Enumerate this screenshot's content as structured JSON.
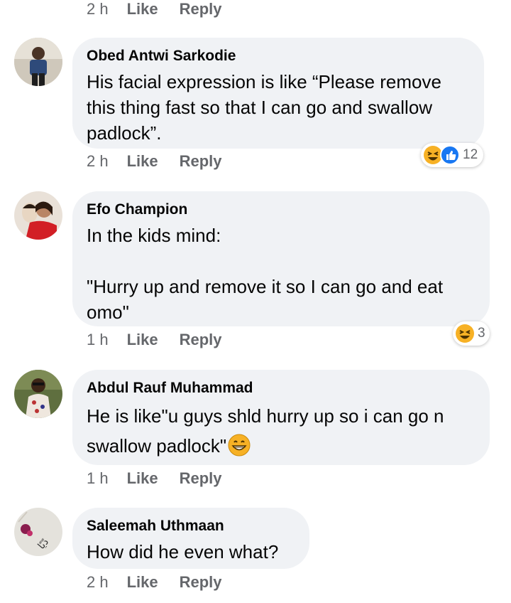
{
  "top_meta": {
    "time": "2 h",
    "like": "Like",
    "reply": "Reply"
  },
  "comments": [
    {
      "author": "Obed Antwi Sarkodie",
      "text": "His facial expression is like “Please remove this thing fast so that I can go and swallow padlock”.",
      "time": "2 h",
      "like": "Like",
      "reply": "Reply",
      "reaction_count": "12",
      "reactions": [
        "laugh-emoji",
        "like-thumb"
      ]
    },
    {
      "author": "Efo Champion",
      "text": "In the kids mind:\n\n\"Hurry up and remove it so I can go and eat omo\"",
      "time": "1 h",
      "like": "Like",
      "reply": "Reply",
      "reaction_count": "3",
      "reactions": [
        "laugh-emoji"
      ]
    },
    {
      "author": "Abdul Rauf Muhammad",
      "text_line1": "He is like\"u guys shld hurry up so i can go n",
      "text_line2": "swallow padlock\"",
      "inline_emoji": "grinning-emoji",
      "time": "1 h",
      "like": "Like",
      "reply": "Reply"
    },
    {
      "author": "Saleemah Uthmaan",
      "text": "How did he even what?",
      "time": "2 h",
      "like": "Like",
      "reply": "Reply"
    }
  ],
  "colors": {
    "bubble": "#f0f2f5",
    "meta_text": "#65676b",
    "like_blue": "#1877f2",
    "emoji_yellow": "#f7b125"
  }
}
